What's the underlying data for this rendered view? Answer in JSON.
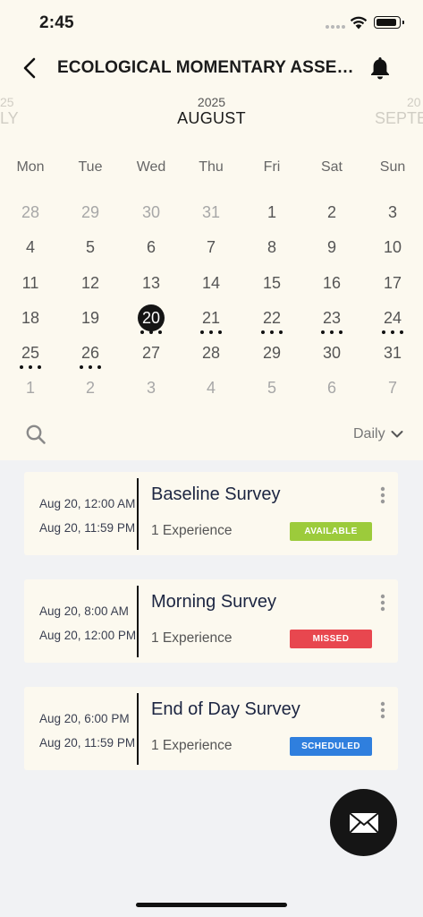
{
  "status_bar": {
    "time": "2:45"
  },
  "header": {
    "title": "ECOLOGICAL MOMENTARY ASSESSMENTS"
  },
  "month_nav": {
    "prev_year": "25",
    "prev_month": "LY",
    "year": "2025",
    "month": "AUGUST",
    "next_year": "20",
    "next_month": "SEPTE"
  },
  "calendar": {
    "weekdays": [
      "Mon",
      "Tue",
      "Wed",
      "Thu",
      "Fri",
      "Sat",
      "Sun"
    ],
    "weeks": [
      [
        {
          "d": "28",
          "muted": true
        },
        {
          "d": "29",
          "muted": true
        },
        {
          "d": "30",
          "muted": true
        },
        {
          "d": "31",
          "muted": true
        },
        {
          "d": "1"
        },
        {
          "d": "2"
        },
        {
          "d": "3"
        }
      ],
      [
        {
          "d": "4"
        },
        {
          "d": "5"
        },
        {
          "d": "6"
        },
        {
          "d": "7"
        },
        {
          "d": "8"
        },
        {
          "d": "9"
        },
        {
          "d": "10"
        }
      ],
      [
        {
          "d": "11"
        },
        {
          "d": "12"
        },
        {
          "d": "13"
        },
        {
          "d": "14"
        },
        {
          "d": "15"
        },
        {
          "d": "16"
        },
        {
          "d": "17"
        }
      ],
      [
        {
          "d": "18"
        },
        {
          "d": "19"
        },
        {
          "d": "20",
          "selected": true,
          "dots": true
        },
        {
          "d": "21",
          "dots": true
        },
        {
          "d": "22",
          "dots": true
        },
        {
          "d": "23",
          "dots": true
        },
        {
          "d": "24",
          "dots": true
        }
      ],
      [
        {
          "d": "25",
          "dots": true
        },
        {
          "d": "26",
          "dots": true
        },
        {
          "d": "27"
        },
        {
          "d": "28"
        },
        {
          "d": "29"
        },
        {
          "d": "30"
        },
        {
          "d": "31"
        }
      ],
      [
        {
          "d": "1",
          "muted": true
        },
        {
          "d": "2",
          "muted": true
        },
        {
          "d": "3",
          "muted": true
        },
        {
          "d": "4",
          "muted": true
        },
        {
          "d": "5",
          "muted": true
        },
        {
          "d": "6",
          "muted": true
        },
        {
          "d": "7",
          "muted": true
        }
      ]
    ]
  },
  "toolbar": {
    "view": "Daily",
    "search_icon": "search-icon"
  },
  "surveys": [
    {
      "start": "Aug 20, 12:00 AM",
      "end": "Aug 20, 11:59 PM",
      "name": "Baseline Survey",
      "experience": "1 Experience",
      "status": "AVAILABLE",
      "status_color": "#9ccb3b"
    },
    {
      "start": "Aug 20, 8:00 AM",
      "end": "Aug 20, 12:00 PM",
      "name": "Morning Survey",
      "experience": "1 Experience",
      "status": "MISSED",
      "status_color": "#e8474f"
    },
    {
      "start": "Aug 20, 6:00 PM",
      "end": "Aug 20, 11:59 PM",
      "name": "End of Day Survey",
      "experience": "1 Experience",
      "status": "SCHEDULED",
      "status_color": "#2f7fde"
    }
  ],
  "fab": {
    "icon": "mail-icon"
  }
}
